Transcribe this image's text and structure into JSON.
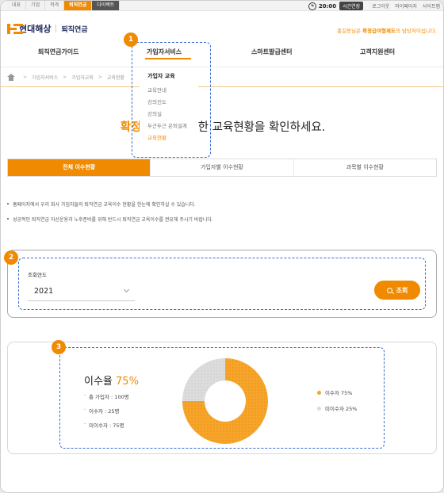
{
  "util_tabs": [
    "대표",
    "기업",
    "적격",
    "퇴직연금",
    "다이렉트"
  ],
  "util_bar": {
    "time": "20:00",
    "extend": "시간연장",
    "links": [
      "로그아웃",
      "마이페이지",
      "사이트맵"
    ]
  },
  "header": {
    "logo_name": "현대해상",
    "logo_sub": "퇴직연금",
    "notice_prefix": "홍길동님은 ",
    "notice_highlight": "확정급여형제도",
    "notice_suffix": "의 담당자이십니다."
  },
  "gnb": [
    "퇴직연금가이드",
    "가입자서비스",
    "스마트발급센터",
    "고객지원센터"
  ],
  "breadcrumb": [
    "가입자서비스",
    "가입자교육",
    "교육현황"
  ],
  "dropdown": {
    "title": "가입자 교육",
    "items": [
      "교육안내",
      "강의진도",
      "강의실",
      "두근두근 은퇴설계",
      "교육현황"
    ]
  },
  "headline": {
    "highlight": "확정급여형",
    "rest": "에 대한 교육현황을 확인하세요."
  },
  "tabs": [
    "전체 이수현황",
    "가입자별 이수현황",
    "과목별 이수현황"
  ],
  "bullets": [
    "홈페이지에서 우리 회사 가입자들의 퇴직연금 교육이수 현황을 한눈에 확인하실 수 있습니다.",
    "성공적인 퇴직연금 자산운용과 노후준비를 위해 반드시 퇴직연금 교육이수를 권유해 주시기 바랍니다."
  ],
  "search": {
    "label": "조회연도",
    "year": "2021",
    "button": "조회"
  },
  "result": {
    "title": "이수율",
    "rate": "75%",
    "stats": [
      "총 가입자 : 100명",
      "이수자 : 25명",
      "미이수자 : 75명"
    ],
    "legend": [
      "이수자 75%",
      "미이수자 25%"
    ]
  },
  "badges": [
    "1",
    "2",
    "3"
  ],
  "chart_data": {
    "type": "pie",
    "categories": [
      "이수자",
      "미이수자"
    ],
    "values": [
      75,
      25
    ],
    "colors": [
      "#f7a42a",
      "#dcdcdc"
    ]
  },
  "colors": {
    "accent": "#f08a00",
    "annotation": "#3a6cd4"
  }
}
